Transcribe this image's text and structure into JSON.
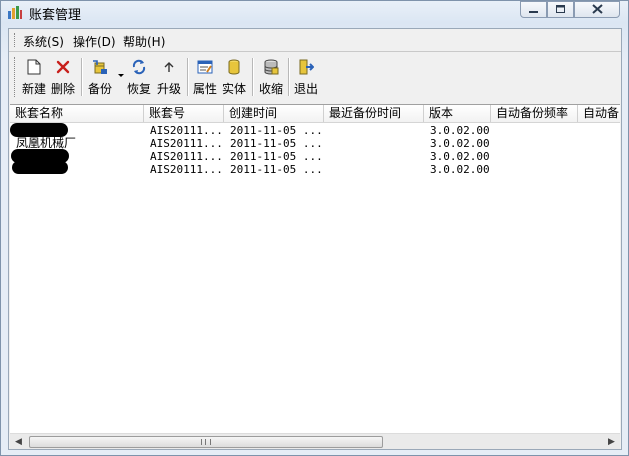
{
  "window": {
    "title": "账套管理",
    "icons": {
      "app": "app-chart-icon",
      "minimize": "minimize-icon",
      "maximize": "maximize-icon",
      "close": "close-icon"
    }
  },
  "menu": {
    "items": [
      {
        "label": "系统(S)"
      },
      {
        "label": "操作(D)"
      },
      {
        "label": "帮助(H)"
      }
    ]
  },
  "toolbar": {
    "buttons": [
      {
        "label": "新建",
        "icon": "new-file-icon"
      },
      {
        "label": "删除",
        "icon": "delete-x-icon"
      },
      {
        "label": "备份",
        "icon": "backup-icon"
      },
      {
        "label": "恢复",
        "icon": "restore-icon"
      },
      {
        "label": "升级",
        "icon": "upgrade-icon"
      },
      {
        "label": "属性",
        "icon": "properties-icon"
      },
      {
        "label": "实体",
        "icon": "entity-icon"
      },
      {
        "label": "收缩",
        "icon": "shrink-icon"
      },
      {
        "label": "退出",
        "icon": "exit-icon"
      }
    ]
  },
  "table": {
    "columns": [
      "账套名称",
      "账套号",
      "创建时间",
      "最近备份时间",
      "版本",
      "自动备份频率",
      "自动备"
    ],
    "rows": [
      {
        "name": "",
        "code": "AIS20111...",
        "created": "2011-11-05 ...",
        "last_backup": "",
        "version": "3.0.02.00",
        "freq": "",
        "auto": ""
      },
      {
        "name": "凤凰机械厂",
        "code": "AIS20111...",
        "created": "2011-11-05 ...",
        "last_backup": "",
        "version": "3.0.02.00",
        "freq": "",
        "auto": ""
      },
      {
        "name": "",
        "code": "AIS20111...",
        "created": "2011-11-05 ...",
        "last_backup": "",
        "version": "3.0.02.00",
        "freq": "",
        "auto": ""
      },
      {
        "name": "",
        "code": "AIS20111...",
        "created": "2011-11-05 ...",
        "last_backup": "",
        "version": "3.0.02.00",
        "freq": "",
        "auto": ""
      }
    ]
  },
  "scrollbar": {
    "left_arrow": "◀",
    "right_arrow": "▶"
  },
  "colors": {
    "titlebar": "#dbe6f3",
    "client_bg": "#f0f0f0",
    "list_bg": "#ffffff",
    "delete_red": "#c8201c",
    "icon_blue": "#2a62b8",
    "icon_yellow": "#e7c53c"
  }
}
